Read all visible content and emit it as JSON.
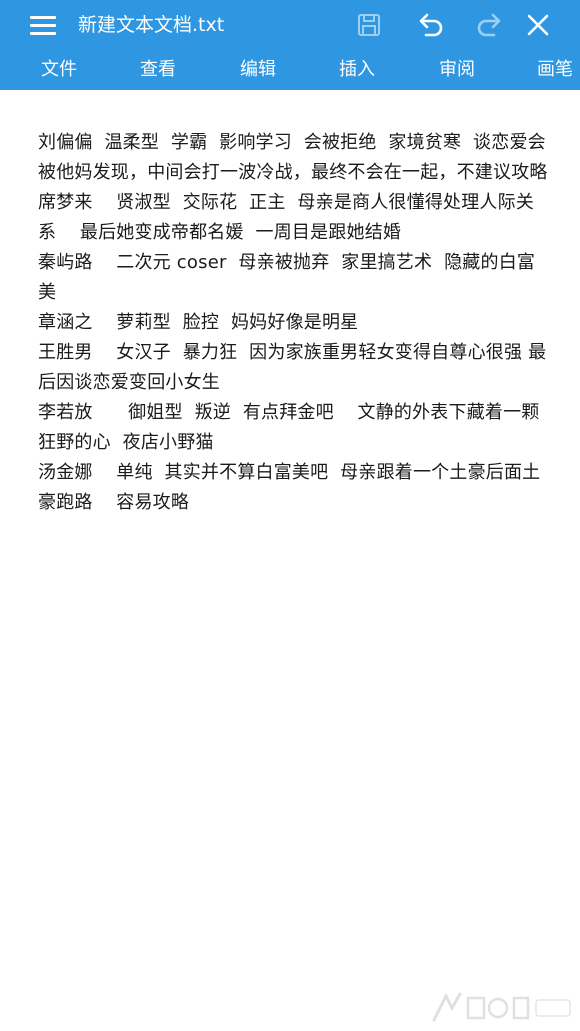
{
  "header": {
    "title": "新建文本文档.txt",
    "menu_icon": "hamburger-menu-icon",
    "save_icon": "save-disk-icon",
    "undo_icon": "undo-icon",
    "redo_icon": "redo-icon",
    "close_icon": "close-icon"
  },
  "tabs": [
    {
      "label": "文件"
    },
    {
      "label": "查看"
    },
    {
      "label": "编辑"
    },
    {
      "label": "插入"
    },
    {
      "label": "审阅"
    },
    {
      "label": "画笔"
    }
  ],
  "document": {
    "text": "刘偏偏  温柔型  学霸  影响学习  会被拒绝  家境贫寒  谈恋爱会被他妈发现，中间会打一波冷战，最终不会在一起，不建议攻略\n席梦来    贤淑型  交际花  正主  母亲是商人很懂得处理人际关系    最后她变成帝都名媛  一周目是跟她结婚\n秦屿路    二次元 coser  母亲被抛弃  家里搞艺术  隐藏的白富美\n章涵之    萝莉型  脸控  妈妈好像是明星\n王胜男    女汉子  暴力狂  因为家族重男轻女变得自尊心很强 最后因谈恋爱变回小女生\n李若放      御姐型  叛逆  有点拜金吧    文静的外表下藏着一颗狂野的心  夜店小野猫\n汤金娜    单纯  其实并不算白富美吧  母亲跟着一个土豪后面土豪跑路    容易攻略"
  },
  "colors": {
    "accent": "#2f97e2",
    "text": "#1b1b1b",
    "background": "#ffffff"
  }
}
